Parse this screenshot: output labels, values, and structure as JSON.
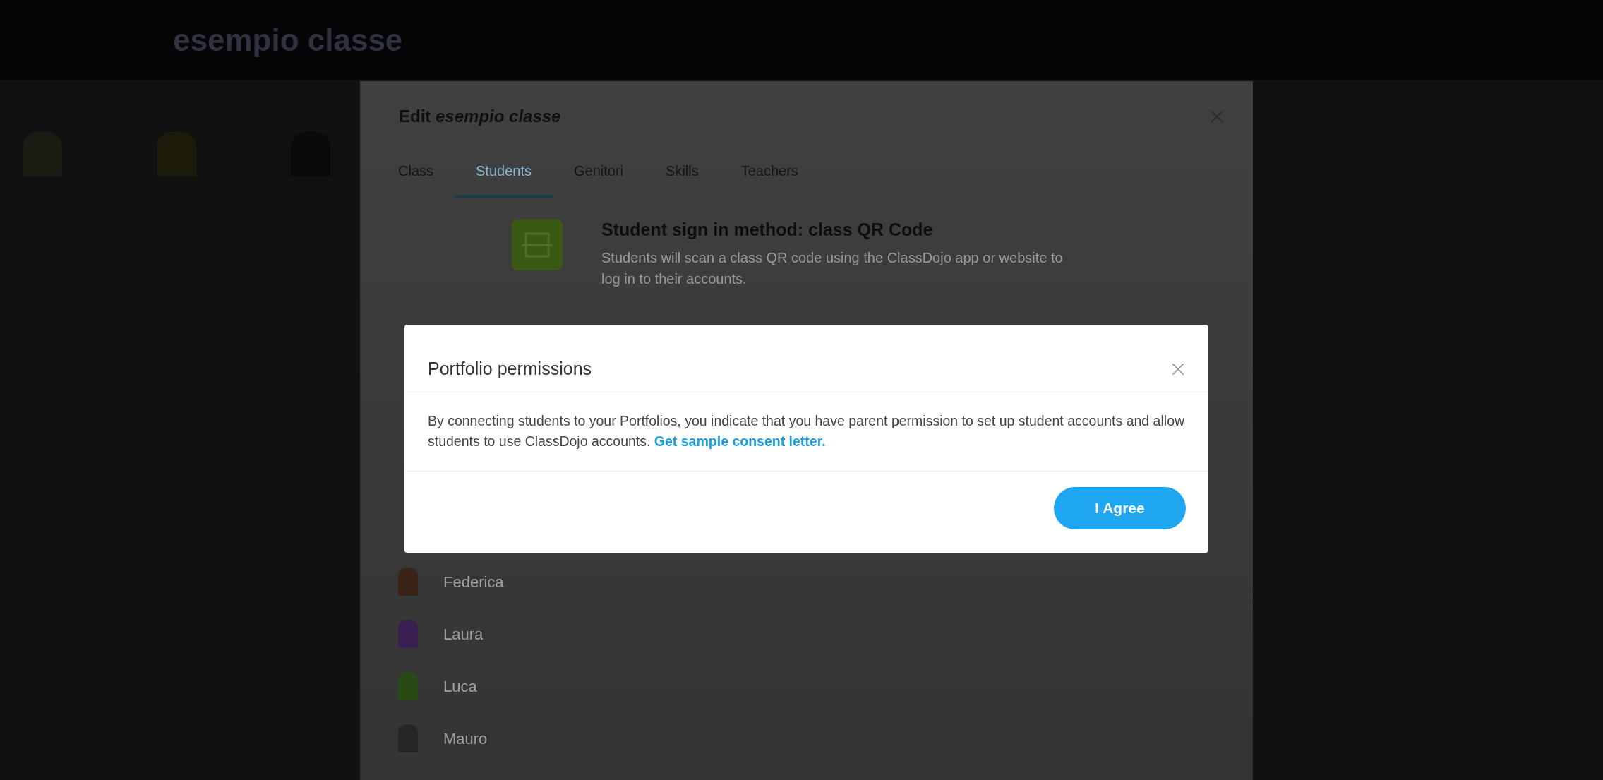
{
  "page": {
    "class_title": "esempio classe"
  },
  "edit_modal": {
    "title": "Edit *esempio classe*",
    "tabs": [
      {
        "label": "Class",
        "selected": false
      },
      {
        "label": "Students",
        "selected": true
      },
      {
        "label": "Genitori",
        "selected": false
      },
      {
        "label": "Skills",
        "selected": false
      },
      {
        "label": "Teachers",
        "selected": false
      }
    ],
    "sign_in": {
      "title": "Student sign in method: class QR Code",
      "description": "Students will scan a class QR code using the ClassDojo app or website to log in to their accounts."
    },
    "students": [
      {
        "name": "Federica",
        "color": "#3a2418"
      },
      {
        "name": "Laura",
        "color": "#3a1f52"
      },
      {
        "name": "Luca",
        "color": "#2a4a14"
      },
      {
        "name": "Mauro",
        "color": "#262626"
      }
    ]
  },
  "dialog": {
    "title": "Portfolio permissions",
    "body": "By connecting students to your Portfolios, you indicate that you have parent permission to set up student accounts and allow students to use ClassDojo accounts.",
    "link": "Get sample consent letter.",
    "button": "I Agree"
  }
}
